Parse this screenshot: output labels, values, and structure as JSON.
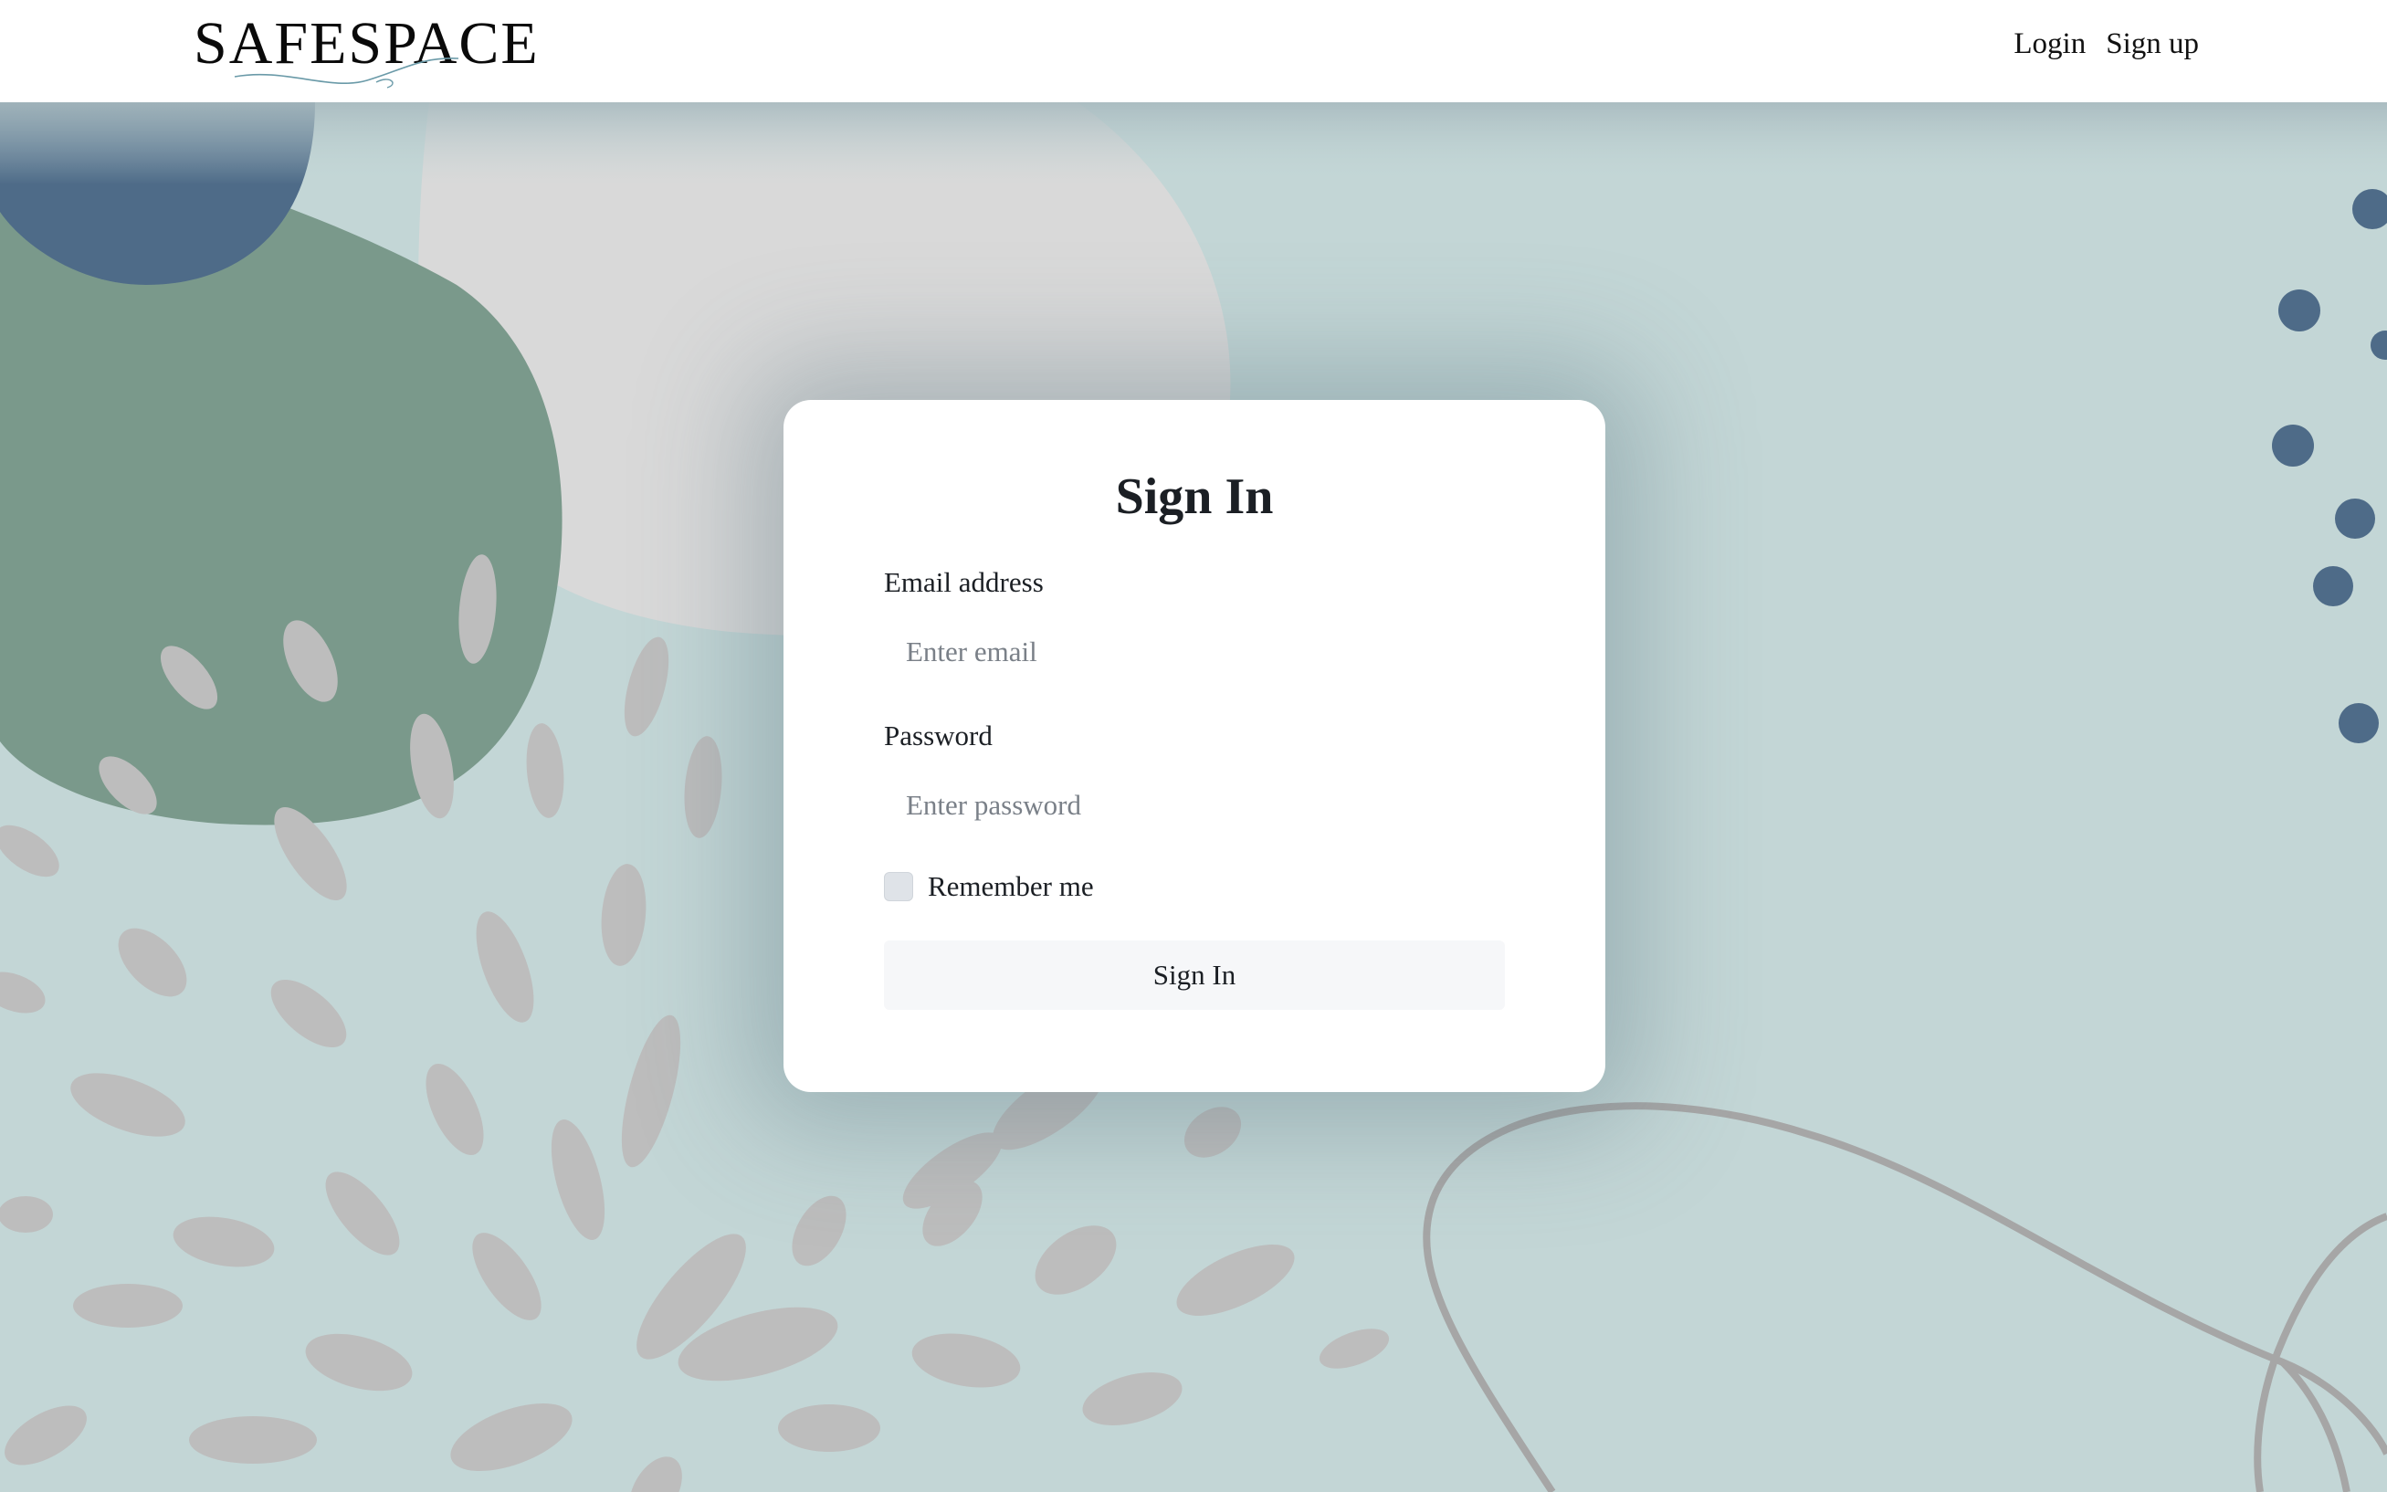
{
  "nav": {
    "brand": "SAFESPACE",
    "links": [
      {
        "label": "Login"
      },
      {
        "label": "Sign up"
      }
    ]
  },
  "form": {
    "title": "Sign In",
    "email": {
      "label": "Email address",
      "placeholder": "Enter email",
      "value": ""
    },
    "password": {
      "label": "Password",
      "placeholder": "Enter password",
      "value": ""
    },
    "remember": {
      "label": "Remember me",
      "checked": false
    },
    "submit_label": "Sign In"
  },
  "colors": {
    "background": "#c3d6d6",
    "blob_blue": "#4e6b88",
    "blob_green": "#7a998b",
    "blob_gray": "#d9d9d9",
    "petals": "#bdbdbd",
    "dots": "#4e6b88"
  }
}
